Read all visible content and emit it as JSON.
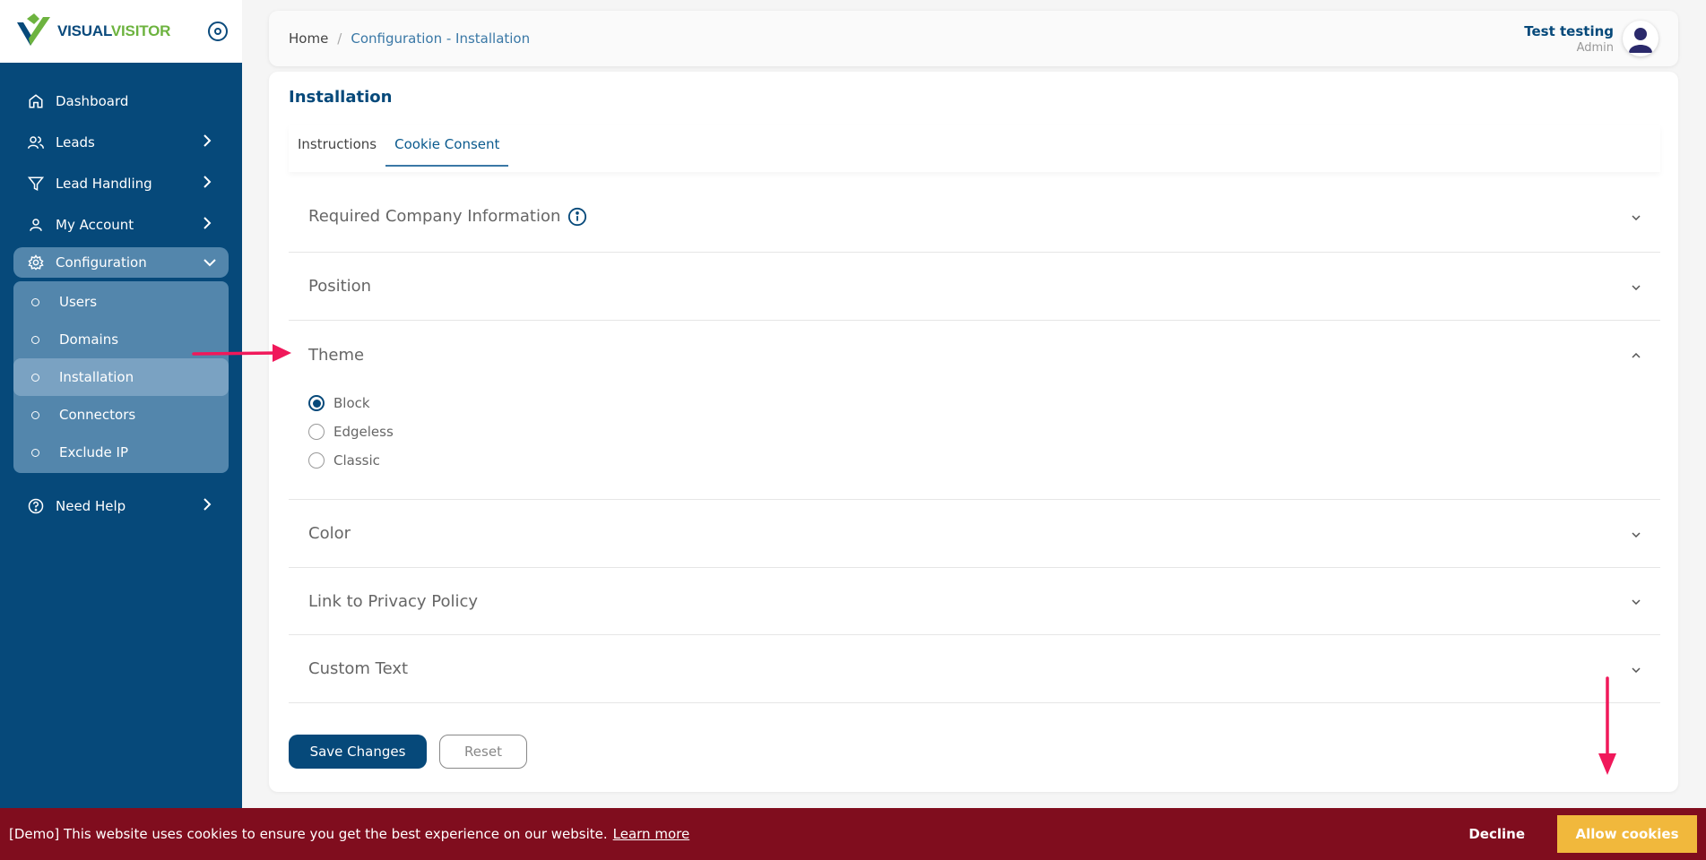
{
  "app": {
    "logo_part1": "VISUAL",
    "logo_part2": "VISITOR"
  },
  "sidebar": {
    "items": [
      {
        "label": "Dashboard",
        "icon": "home-icon"
      },
      {
        "label": "Leads",
        "icon": "users-icon"
      },
      {
        "label": "Lead Handling",
        "icon": "filter-icon"
      },
      {
        "label": "My Account",
        "icon": "user-icon"
      },
      {
        "label": "Configuration",
        "icon": "gear-icon"
      },
      {
        "label": "Need Help",
        "icon": "help-icon"
      }
    ],
    "sub_items": [
      {
        "label": "Users"
      },
      {
        "label": "Domains"
      },
      {
        "label": "Installation"
      },
      {
        "label": "Connectors"
      },
      {
        "label": "Exclude IP"
      }
    ]
  },
  "header": {
    "breadcrumb_home": "Home",
    "breadcrumb_separator": "/",
    "breadcrumb_current": "Configuration - Installation",
    "user_name": "Test testing",
    "user_role": "Admin"
  },
  "main": {
    "title": "Installation",
    "tabs": [
      {
        "label": "Instructions"
      },
      {
        "label": "Cookie Consent"
      }
    ],
    "sections": [
      {
        "label": "Required Company Information"
      },
      {
        "label": "Position"
      },
      {
        "label": "Theme"
      },
      {
        "label": "Color"
      },
      {
        "label": "Link to Privacy Policy"
      },
      {
        "label": "Custom Text"
      }
    ],
    "theme_options": [
      {
        "label": "Block",
        "checked": true
      },
      {
        "label": "Edgeless",
        "checked": false
      },
      {
        "label": "Classic",
        "checked": false
      }
    ],
    "save_label": "Save Changes",
    "reset_label": "Reset"
  },
  "cookie_banner": {
    "text": "[Demo] This website uses cookies to ensure you get the best experience on our website.",
    "learn_more": "Learn more",
    "decline": "Decline",
    "allow": "Allow cookies"
  },
  "colors": {
    "sidebar_bg": "#06497a",
    "accent": "#06497a",
    "cookie_bg": "#800d1e",
    "allow_bg": "#f1b83c",
    "annotation_arrow": "#f0185a"
  }
}
